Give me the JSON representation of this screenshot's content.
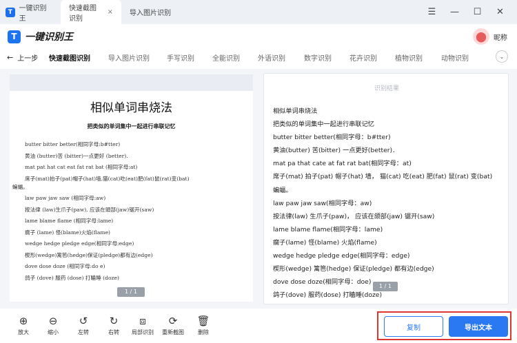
{
  "tabs": [
    {
      "label": "一键识别王"
    },
    {
      "label": "快速截图识别",
      "close": "×"
    },
    {
      "label": "导入图片识别"
    }
  ],
  "window_controls": [
    "☰",
    "—",
    "☐",
    "✕"
  ],
  "brand": {
    "logo_text": "T",
    "name": "一键识别王"
  },
  "user": {
    "nickname": "昵称"
  },
  "nav": {
    "back_label": "上一步",
    "items": [
      "快速截图识别",
      "导入图片识别",
      "手写识别",
      "全能识别",
      "外语识别",
      "数字识别",
      "花卉识别",
      "植物识别",
      "动物识别"
    ]
  },
  "document": {
    "title": "相似单词串烧法",
    "subtitle": "把类似的单词集中一起进行串联记忆",
    "lines": [
      "butter bitter better(相同字母:b#tter)",
      "黄油 (butter)苦 (bitter)一点更好 (better).",
      "mat pat hat cat eat fat rat bat (相同字母:at)",
      "席子(mat)拍子(pat)帽子(hat)墙,猫(cat)吃(eat)肥(fat)鼠(rat)变(bat)",
      "蝙蝠。",
      "law paw jaw saw (相同字母:aw)",
      "按法律 (law)生爪子(paw), 应该在頭部(jaw)锯开(saw)",
      "lame blame flame (相同字母:lame)",
      "瘸子 (lame) 怪(blame)火焰(flame)",
      "wedge hedge pledge edge(相同字母:edge)",
      "楔形(wedge)篱笆(hedge)保证(pledge)都有边(edge)",
      "dove dose doze (相同字母:do e)",
      "鸽子 (dove) 服药 (dose) 打瞌睡 (doze)"
    ],
    "page": "1 / 1"
  },
  "result": {
    "title": "识别结果",
    "lines": [
      "相似单词串烧法",
      "把类似的单词集中一起进行串联记忆",
      "butter bitter better(相同字母：b#tter)",
      "黄油(butter) 苦(bitter) 一点更好(better)．",
      "mat pa that cate at fat rat bat(相同字母：at)",
      "席子(mat) 拍子(pat) 帽子(hat) 墙， 猫(cat) 吃(eat) 肥(fat) 鼠(rat) 变(bat)",
      "蝙蝠。",
      "law paw jaw saw(相同字母：aw)",
      "按法律(law) 生爪子(paw)， 应该在颌部(jaw) 锯开(saw)",
      "lame blame flame(相同字母：lame)",
      "瘸子(lame) 怪(blame) 火焰(flame)",
      "wedge hedge pledge edge(相同字母：edge)",
      "楔形(wedge) 篱笆(hedge) 保证(pledge) 都有边(edge)",
      "dove dose doze(相同字母：doe)",
      "鸽子(dove) 服药(dose) 打瞌睡(doze)"
    ],
    "page": "1 / 1"
  },
  "toolbar": {
    "tools": [
      {
        "icon": "⊕",
        "label": "放大"
      },
      {
        "icon": "⊖",
        "label": "缩小"
      },
      {
        "icon": "↺",
        "label": "左转"
      },
      {
        "icon": "↻",
        "label": "右转"
      },
      {
        "icon": "⧈",
        "label": "局部识别"
      },
      {
        "icon": "⟳",
        "label": "重新截图"
      },
      {
        "icon": "🗑",
        "label": "删除"
      }
    ],
    "copy_label": "复制",
    "export_label": "导出文本"
  }
}
